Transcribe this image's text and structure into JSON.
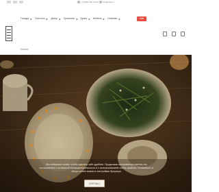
{
  "topbar": {
    "phone": "+7 (000) 000-00-00",
    "email": "info@mail.ru"
  },
  "nav": {
    "items": [
      {
        "label": "Посуда"
      },
      {
        "label": "Текстиль"
      },
      {
        "label": "Декор"
      },
      {
        "label": "Хранение"
      },
      {
        "label": "Кухня"
      },
      {
        "label": "Мебель"
      },
      {
        "label": "Новинки"
      },
      {
        "label": "Sale"
      }
    ],
    "accent_label": "Sale"
  },
  "header": {
    "sub_label": "Каталог"
  },
  "cookie": {
    "text": "Мы собираем cookie, чтобы сделать сайт удобнее. Продолжая пользоваться сайтом, вы соглашаетесь с политикой конфиденциальности и с использованием cookie-файлов. Отказаться от сбора cookie можно в настройках браузера.",
    "button_label": "ХОРОШО"
  },
  "colors": {
    "accent": "#e74c3c",
    "hero_dark": "#3a2716",
    "button_bg": "#f3f0ea"
  },
  "icons": [
    "logo",
    "search-icon",
    "user-icon",
    "cart-icon",
    "phone-icon",
    "mail-icon"
  ]
}
